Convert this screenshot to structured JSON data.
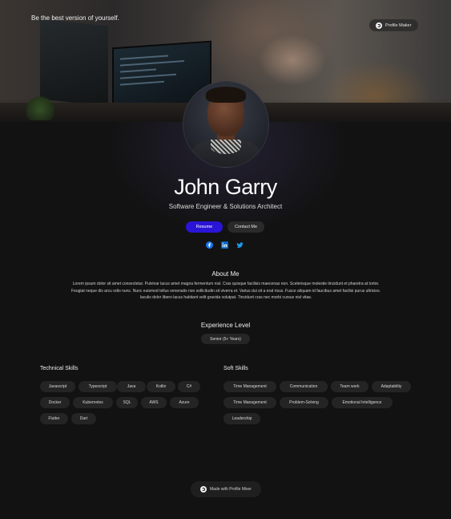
{
  "hero": {
    "tagline": "Be the best version of yourself.",
    "brand_label": "Profile Maker"
  },
  "profile": {
    "name": "John Garry",
    "role": "Software Engineer & Solutions Architect",
    "resume_label": "Resume",
    "contact_label": "Contact Me"
  },
  "socials": [
    "facebook-icon",
    "linkedin-icon",
    "twitter-icon"
  ],
  "colors": {
    "accent": "#2a14d6",
    "background": "#121212",
    "facebook": "#1877f2",
    "linkedin": "#0a66c2",
    "twitter": "#1d9bf0"
  },
  "about": {
    "title": "About Me",
    "text": "Lorem ipsum dolor sit amet consectetur. Pulvinar lacus amet magna fermentum nisl. Cras quisque facilisis maecenas non. Scelerisque molestie tincidunt et pharetra at tortor. Feugiat neque dis arcu odio nunc. Nunc euismod tellus venenatis non sollicitudin sit viverra et. Varius dui sit a erat risus. Fusce aliquam id faucibus amet facilisi purus ultricies. Iaculis dolor libero lacus habitant velit gravida volutpat. Tincidunt cras nec morbi cursus nisl vitae."
  },
  "experience": {
    "title": "Experience Level",
    "value": "Senior (5+ Years)"
  },
  "technical_skills": {
    "title": "Technical Skills",
    "items": [
      "Javascript",
      "Typescript",
      "Java",
      "Kotlin",
      "C#",
      "Docker",
      "Kubernetes",
      "SQL",
      "AWS",
      "Azure",
      "Flutter",
      "Dart"
    ]
  },
  "soft_skills": {
    "title": "Soft Skills",
    "items": [
      "Time Management",
      "Communication",
      "Team work",
      "Adaptability",
      "Time Management",
      "Problem-Solving",
      "Emotional Intelligence",
      "Leadership"
    ]
  },
  "footer": {
    "label": "Made with Profile Mixer"
  }
}
